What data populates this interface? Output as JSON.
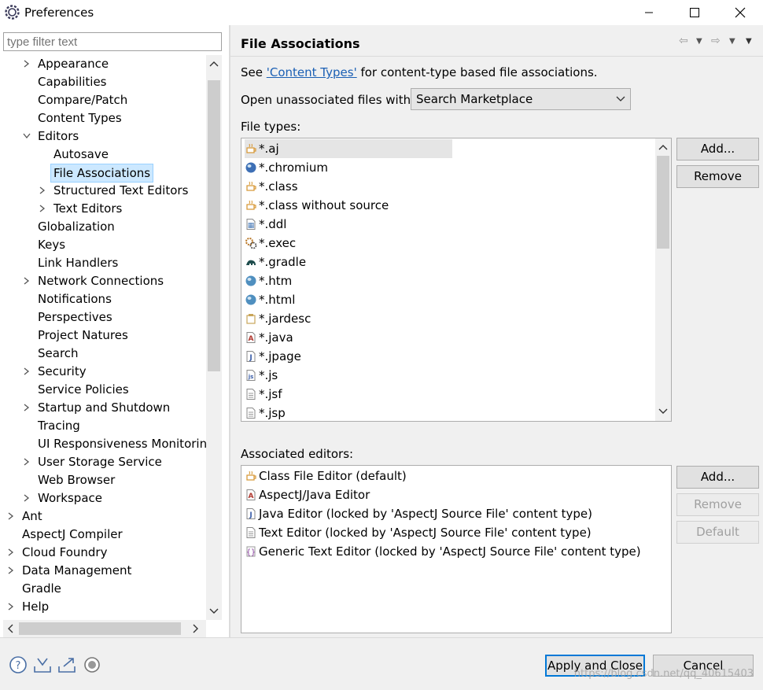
{
  "window": {
    "title": "Preferences"
  },
  "filter": {
    "placeholder": "type filter text"
  },
  "tree": [
    {
      "label": "Appearance",
      "level": 1,
      "twisty": "collapsed"
    },
    {
      "label": "Capabilities",
      "level": 1,
      "twisty": "none"
    },
    {
      "label": "Compare/Patch",
      "level": 1,
      "twisty": "none"
    },
    {
      "label": "Content Types",
      "level": 1,
      "twisty": "none"
    },
    {
      "label": "Editors",
      "level": 1,
      "twisty": "expanded"
    },
    {
      "label": "Autosave",
      "level": 2,
      "twisty": "none"
    },
    {
      "label": "File Associations",
      "level": 2,
      "twisty": "none",
      "selected": true
    },
    {
      "label": "Structured Text Editors",
      "level": 2,
      "twisty": "collapsed"
    },
    {
      "label": "Text Editors",
      "level": 2,
      "twisty": "collapsed"
    },
    {
      "label": "Globalization",
      "level": 1,
      "twisty": "none"
    },
    {
      "label": "Keys",
      "level": 1,
      "twisty": "none"
    },
    {
      "label": "Link Handlers",
      "level": 1,
      "twisty": "none"
    },
    {
      "label": "Network Connections",
      "level": 1,
      "twisty": "collapsed"
    },
    {
      "label": "Notifications",
      "level": 1,
      "twisty": "none"
    },
    {
      "label": "Perspectives",
      "level": 1,
      "twisty": "none"
    },
    {
      "label": "Project Natures",
      "level": 1,
      "twisty": "none"
    },
    {
      "label": "Search",
      "level": 1,
      "twisty": "none"
    },
    {
      "label": "Security",
      "level": 1,
      "twisty": "collapsed"
    },
    {
      "label": "Service Policies",
      "level": 1,
      "twisty": "none"
    },
    {
      "label": "Startup and Shutdown",
      "level": 1,
      "twisty": "collapsed"
    },
    {
      "label": "Tracing",
      "level": 1,
      "twisty": "none"
    },
    {
      "label": "UI Responsiveness Monitoring",
      "level": 1,
      "twisty": "none"
    },
    {
      "label": "User Storage Service",
      "level": 1,
      "twisty": "collapsed"
    },
    {
      "label": "Web Browser",
      "level": 1,
      "twisty": "none"
    },
    {
      "label": "Workspace",
      "level": 1,
      "twisty": "collapsed"
    },
    {
      "label": "Ant",
      "level": 0,
      "twisty": "collapsed"
    },
    {
      "label": "AspectJ Compiler",
      "level": 0,
      "twisty": "none"
    },
    {
      "label": "Cloud Foundry",
      "level": 0,
      "twisty": "collapsed"
    },
    {
      "label": "Data Management",
      "level": 0,
      "twisty": "collapsed"
    },
    {
      "label": "Gradle",
      "level": 0,
      "twisty": "none"
    },
    {
      "label": "Help",
      "level": 0,
      "twisty": "collapsed"
    }
  ],
  "page": {
    "title": "File Associations",
    "see_prefix": "See ",
    "see_link": "'Content Types'",
    "see_suffix": " for content-type based file associations.",
    "open_label": "Open unassociated files with:",
    "open_value": "Search Marketplace",
    "file_types_label": "File types:",
    "associated_label": "Associated editors:"
  },
  "file_types": [
    {
      "label": "*.aj",
      "icon": "class-file-icon",
      "color": "#d89a3a"
    },
    {
      "label": "*.chromium",
      "icon": "chromium-icon",
      "color": "#3d6fb5"
    },
    {
      "label": "*.class",
      "icon": "class-file-icon",
      "color": "#d89a3a"
    },
    {
      "label": "*.class without source",
      "icon": "class-file-icon",
      "color": "#d89a3a"
    },
    {
      "label": "*.ddl",
      "icon": "ddl-file-icon",
      "color": "#4a7bb7"
    },
    {
      "label": "*.exec",
      "icon": "gears-icon",
      "color": "#b7721e"
    },
    {
      "label": "*.gradle",
      "icon": "gradle-elephant-icon",
      "color": "#1f4d4d"
    },
    {
      "label": "*.htm",
      "icon": "globe-icon",
      "color": "#4f8fbf"
    },
    {
      "label": "*.html",
      "icon": "globe-icon",
      "color": "#4f8fbf"
    },
    {
      "label": "*.jardesc",
      "icon": "jar-icon",
      "color": "#c9a55a"
    },
    {
      "label": "*.java",
      "icon": "aspectj-file-icon",
      "color": "#b0382f"
    },
    {
      "label": "*.jpage",
      "icon": "java-file-icon",
      "color": "#3b5ea8"
    },
    {
      "label": "*.js",
      "icon": "js-file-icon",
      "color": "#3b5ea8"
    },
    {
      "label": "*.jsf",
      "icon": "text-file-icon",
      "color": "#8a8a8a"
    },
    {
      "label": "*.jsp",
      "icon": "text-file-icon",
      "color": "#8a8a8a"
    }
  ],
  "associated_editors": [
    {
      "label": "Class File Editor (default)",
      "icon": "class-file-icon",
      "color": "#d89a3a"
    },
    {
      "label": "AspectJ/Java Editor",
      "icon": "aspectj-file-icon",
      "color": "#b0382f"
    },
    {
      "label": "Java Editor (locked by 'AspectJ Source File' content type)",
      "icon": "java-file-icon",
      "color": "#3b5ea8"
    },
    {
      "label": "Text Editor (locked by 'AspectJ Source File' content type)",
      "icon": "text-file-icon",
      "color": "#8a8a8a"
    },
    {
      "label": "Generic Text Editor (locked by 'AspectJ Source File' content type)",
      "icon": "generic-editor-icon",
      "color": "#8a3fa0"
    }
  ],
  "buttons": {
    "add": "Add...",
    "remove": "Remove",
    "add2": "Add...",
    "remove2": "Remove",
    "default": "Default",
    "apply_close": "Apply and Close",
    "cancel": "Cancel"
  },
  "watermark": "https://blog.csdn.net/qq_40615403",
  "colors": {
    "selection": "#cce8ff",
    "link": "#1a5fb4",
    "primary_border": "#0078d7"
  }
}
